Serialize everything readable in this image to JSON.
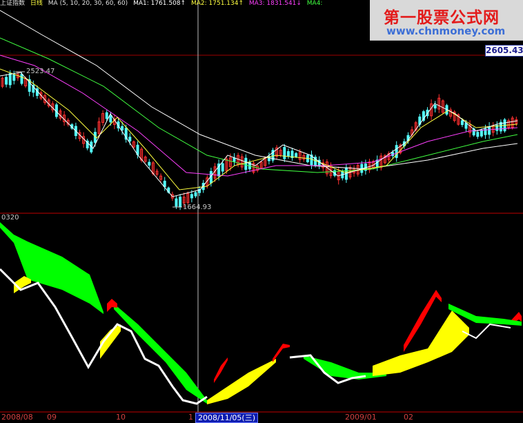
{
  "header": {
    "index_name": "上证指数",
    "period": "日线",
    "ma_params": "MA (5, 10, 20, 30, 60, 60)",
    "ma1": "MA1: 1761.508↑",
    "ma2": "MA2: 1751.134↑",
    "ma3": "MA3: 1831.541↓",
    "ma4": "MA4:"
  },
  "watermark": {
    "title": "第一股票公式网",
    "url": "www.chnmoney.com"
  },
  "price_axis_value": "2605.43",
  "annotations": {
    "high": "2523.47",
    "low": "1664.93"
  },
  "indicator_label": "0320",
  "x_axis": {
    "labels": [
      "2008/08",
      "09",
      "10",
      "1",
      "2009/01",
      "02"
    ],
    "crosshair_date": "2008/11/05(三)"
  },
  "colors": {
    "background": "#000000",
    "up_candle": "#ff3030",
    "down_candle": "#54ffff",
    "ma_white": "#ffffff",
    "ma_yellow": "#ffff40",
    "ma_magenta": "#ff40ff",
    "ma_green": "#40ff40",
    "band_green": "#00ff00",
    "band_yellow": "#ffff00",
    "band_red": "#ff0000",
    "frame": "#c00000"
  }
}
